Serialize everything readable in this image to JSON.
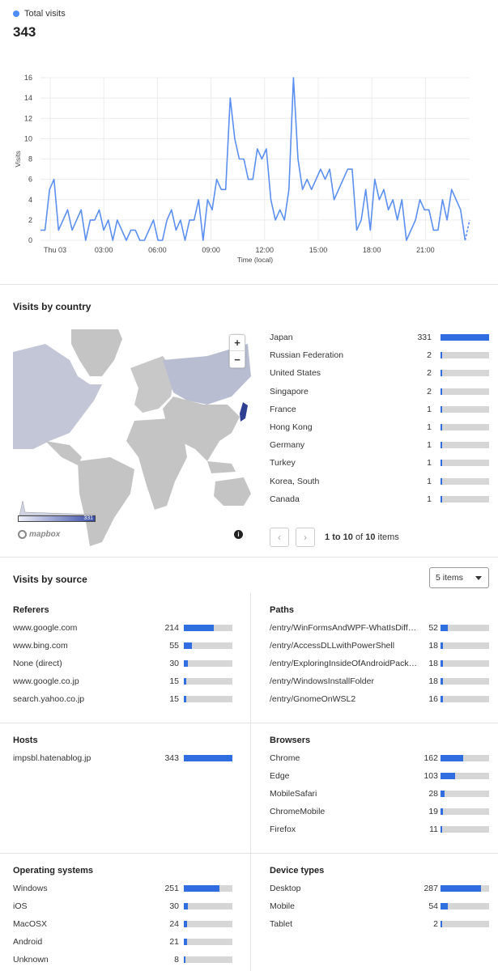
{
  "total": {
    "legend_label": "Total visits",
    "value": "343",
    "color": "#4f8ef7"
  },
  "chart_data": {
    "type": "line",
    "xlabel": "Time (local)",
    "ylabel": "Visits",
    "ylim": [
      0,
      16
    ],
    "yticks": [
      "0",
      "2",
      "4",
      "6",
      "8",
      "10",
      "12",
      "14",
      "16"
    ],
    "xticks": [
      "Thu 03",
      "03:00",
      "06:00",
      "09:00",
      "12:00",
      "15:00",
      "18:00",
      "21:00"
    ],
    "grid": true,
    "series": [
      {
        "values": [
          1,
          1,
          5,
          6,
          1,
          2,
          3,
          1,
          2,
          3,
          0,
          2,
          2,
          3,
          1,
          2,
          0,
          2,
          1,
          0,
          1,
          1,
          0,
          0,
          1,
          2,
          0,
          0,
          2,
          3,
          1,
          2,
          0,
          2,
          2,
          4,
          0,
          4,
          3,
          6,
          5,
          5,
          14,
          10,
          8,
          8,
          6,
          6,
          9,
          8,
          9,
          4,
          2,
          3,
          2,
          5,
          16,
          8,
          5,
          6,
          5,
          6,
          7,
          6,
          7,
          4,
          5,
          6,
          7,
          7,
          1,
          2,
          5,
          1,
          6,
          4,
          5,
          3,
          4,
          2,
          4,
          0,
          1,
          2,
          4,
          3,
          3,
          1,
          1,
          4,
          2,
          5,
          4,
          3,
          0,
          2
        ],
        "dashed_last": true
      }
    ]
  },
  "country": {
    "title": "Visits by country",
    "max": 331,
    "scale_max_label": "331",
    "mapbox_label": "mapbox",
    "zoom_in": "+",
    "zoom_out": "−",
    "info_label": "i",
    "items": [
      {
        "name": "Japan",
        "value": 331
      },
      {
        "name": "Russian Federation",
        "value": 2
      },
      {
        "name": "United States",
        "value": 2
      },
      {
        "name": "Singapore",
        "value": 2
      },
      {
        "name": "France",
        "value": 1
      },
      {
        "name": "Hong Kong",
        "value": 1
      },
      {
        "name": "Germany",
        "value": 1
      },
      {
        "name": "Turkey",
        "value": 1
      },
      {
        "name": "Korea, South",
        "value": 1
      },
      {
        "name": "Canada",
        "value": 1
      }
    ],
    "pager": {
      "prev": "‹",
      "next": "›",
      "from": "1",
      "to_word": "to",
      "to": "10",
      "of_word": "of",
      "total": "10",
      "items_word": "items"
    }
  },
  "source": {
    "title": "Visits by source",
    "select_value": "5 items",
    "panels": {
      "referers": {
        "title": "Referers",
        "max": 343,
        "items": [
          {
            "name": "www.google.com",
            "value": 214
          },
          {
            "name": "www.bing.com",
            "value": 55
          },
          {
            "name": "None (direct)",
            "value": 30
          },
          {
            "name": "www.google.co.jp",
            "value": 15
          },
          {
            "name": "search.yahoo.co.jp",
            "value": 15
          }
        ]
      },
      "paths": {
        "title": "Paths",
        "max": 343,
        "items": [
          {
            "name": "/entry/WinFormsAndWPF-WhatIsDiffe...",
            "value": 52
          },
          {
            "name": "/entry/AccessDLLwithPowerShell",
            "value": 18
          },
          {
            "name": "/entry/ExploringInsideOfAndroidPacka...",
            "value": 18
          },
          {
            "name": "/entry/WindowsInstallFolder",
            "value": 18
          },
          {
            "name": "/entry/GnomeOnWSL2",
            "value": 16
          }
        ]
      },
      "hosts": {
        "title": "Hosts",
        "max": 343,
        "items": [
          {
            "name": "impsbl.hatenablog.jp",
            "value": 343
          }
        ]
      },
      "browsers": {
        "title": "Browsers",
        "max": 343,
        "items": [
          {
            "name": "Chrome",
            "value": 162
          },
          {
            "name": "Edge",
            "value": 103
          },
          {
            "name": "MobileSafari",
            "value": 28
          },
          {
            "name": "ChromeMobile",
            "value": 19
          },
          {
            "name": "Firefox",
            "value": 11
          }
        ]
      },
      "os": {
        "title": "Operating systems",
        "max": 343,
        "items": [
          {
            "name": "Windows",
            "value": 251
          },
          {
            "name": "iOS",
            "value": 30
          },
          {
            "name": "MacOSX",
            "value": 24
          },
          {
            "name": "Android",
            "value": 21
          },
          {
            "name": "Unknown",
            "value": 8
          }
        ]
      },
      "devices": {
        "title": "Device types",
        "max": 343,
        "items": [
          {
            "name": "Desktop",
            "value": 287
          },
          {
            "name": "Mobile",
            "value": 54
          },
          {
            "name": "Tablet",
            "value": 2
          }
        ]
      }
    }
  }
}
